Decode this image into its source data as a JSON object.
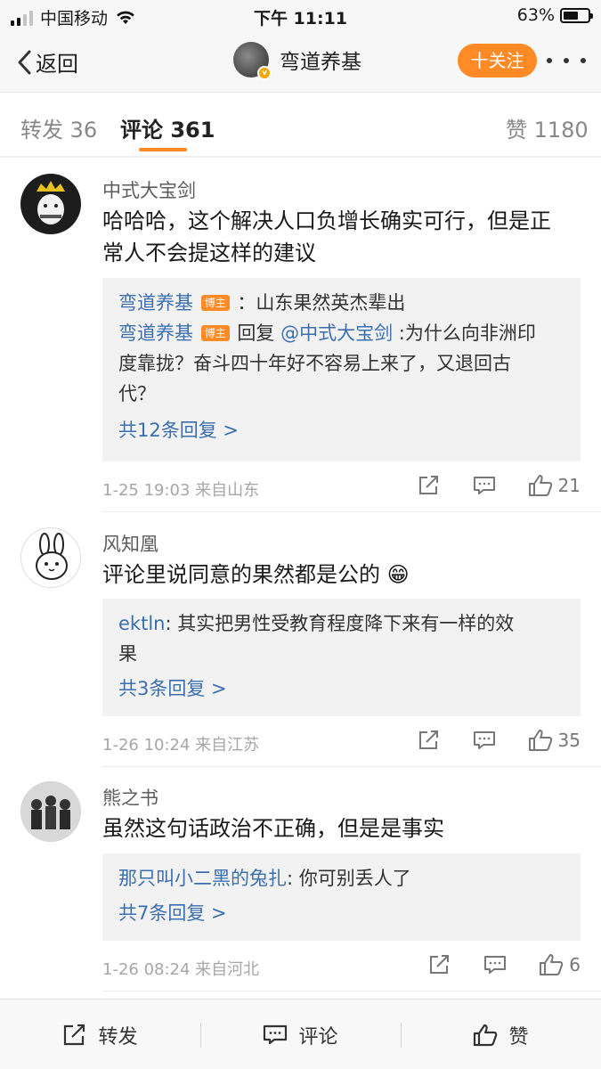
{
  "status_bar": {
    "carrier": "中国移动",
    "time": "下午 11:11",
    "battery": "63%",
    "battery_level": 0.63,
    "signal_bars": 2,
    "icons": [
      "signal-icon",
      "wifi-icon",
      "battery-icon"
    ]
  },
  "nav": {
    "back_label": "返回",
    "title": "弯道养基",
    "verified_mark": "v",
    "follow_label": "十关注",
    "accent": "#ff8a26"
  },
  "tabs": {
    "repost": "转发 36",
    "comments": "评论 361",
    "likes": "赞 1180"
  },
  "comments": [
    {
      "user": "中式大宝剑",
      "text_line1": "哈哈哈，这个解决人口负增长确实可行，但是正",
      "text_line2": "常人不会提这样的建议",
      "replies": [
        {
          "name": "弯道养基",
          "badge": "博主",
          "text": "：山东果然英杰辈出"
        },
        {
          "name": "弯道养基",
          "badge": "博主",
          "reply_word": " 回复 ",
          "mention": "@中式大宝剑",
          "text_line1": ":为什么向非洲印",
          "text_line2": "度靠拢？奋斗四十年好不容易上来了，又退回古",
          "text_line3": "代？"
        }
      ],
      "more_replies": "共12条回复 >",
      "meta": "1-25 19:03  来自山东",
      "likes": "21"
    },
    {
      "user": "风知凰",
      "text": "评论里说同意的果然都是公的",
      "emoji": "😁",
      "replies": [
        {
          "name": "ektln",
          "text_line1": ": 其实把男性受教育程度降下来有一样的效",
          "text_line2": "果"
        }
      ],
      "more_replies": "共3条回复 >",
      "meta": "1-26 10:24  来自江苏",
      "likes": "35"
    },
    {
      "user": "熊之书",
      "text": "虽然这句话政治不正确，但是是事实",
      "replies": [
        {
          "name": "那只叫小二黑的兔扎",
          "text": ": 你可别丢人了"
        }
      ],
      "more_replies": "共7条回复 >",
      "meta": "1-26 08:24  来自河北",
      "likes": "6"
    }
  ],
  "bottom_bar": {
    "repost": "转发",
    "comment": "评论",
    "like": "赞"
  }
}
